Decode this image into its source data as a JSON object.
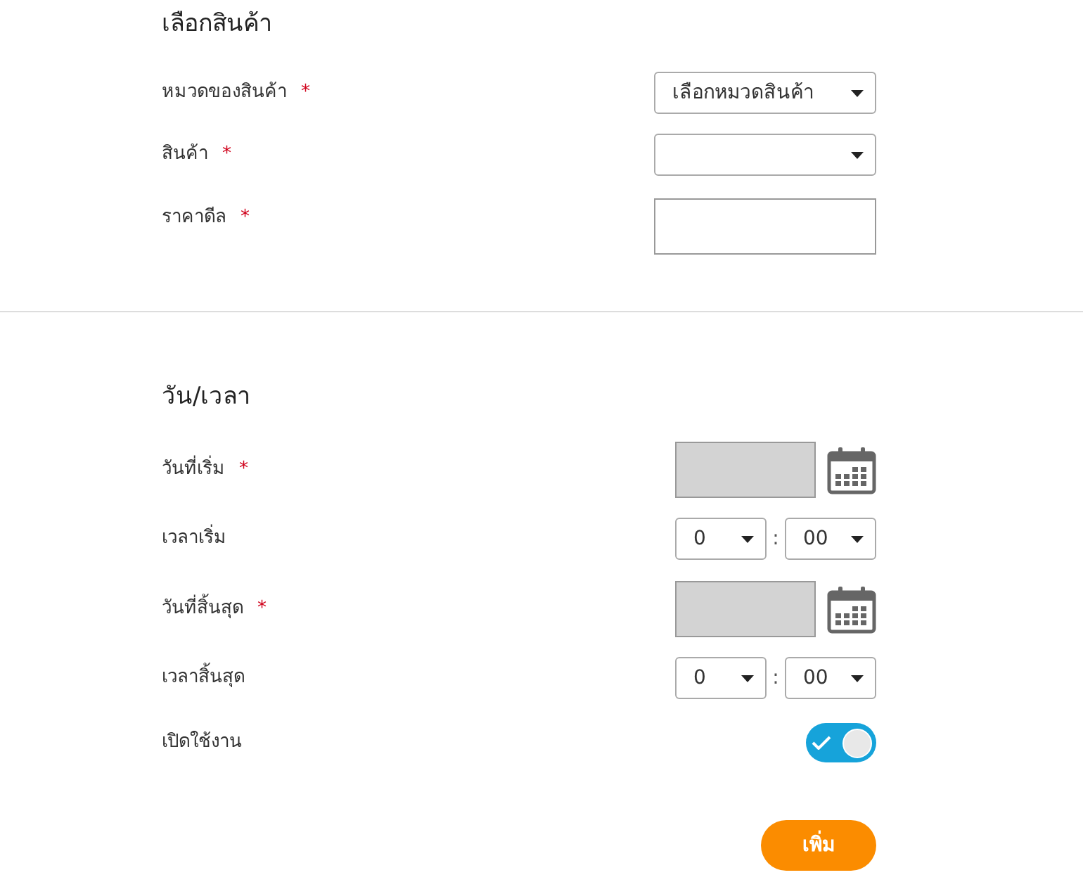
{
  "sections": [
    {
      "title": "เลือกสินค้า",
      "fields": [
        {
          "kind": "select",
          "label": "หมวดของสินค้า",
          "required_mark": "*",
          "value": "เลือกหมวดสินค้า"
        },
        {
          "kind": "select",
          "label": "สินค้า",
          "required_mark": "*"
        },
        {
          "kind": "text",
          "label": "ราคาดีล",
          "required_mark": "*"
        }
      ]
    },
    {
      "title": "วัน/เวลา",
      "fields": [
        {
          "kind": "date",
          "label": "วันที่เริ่ม",
          "required_mark": "*"
        },
        {
          "kind": "time",
          "label": "เวลาเริ่ม",
          "hour": "0",
          "separator": ":",
          "minute": "00"
        },
        {
          "kind": "date",
          "label": "วันที่สิ้นสุด",
          "required_mark": "*"
        },
        {
          "kind": "time",
          "label": "เวลาสิ้นสุด",
          "hour": "0",
          "separator": ":",
          "minute": "00"
        },
        {
          "kind": "toggle",
          "label": "เปิดใช้งาน",
          "on": true
        }
      ]
    }
  ],
  "submit_button": "เพิ่ม"
}
